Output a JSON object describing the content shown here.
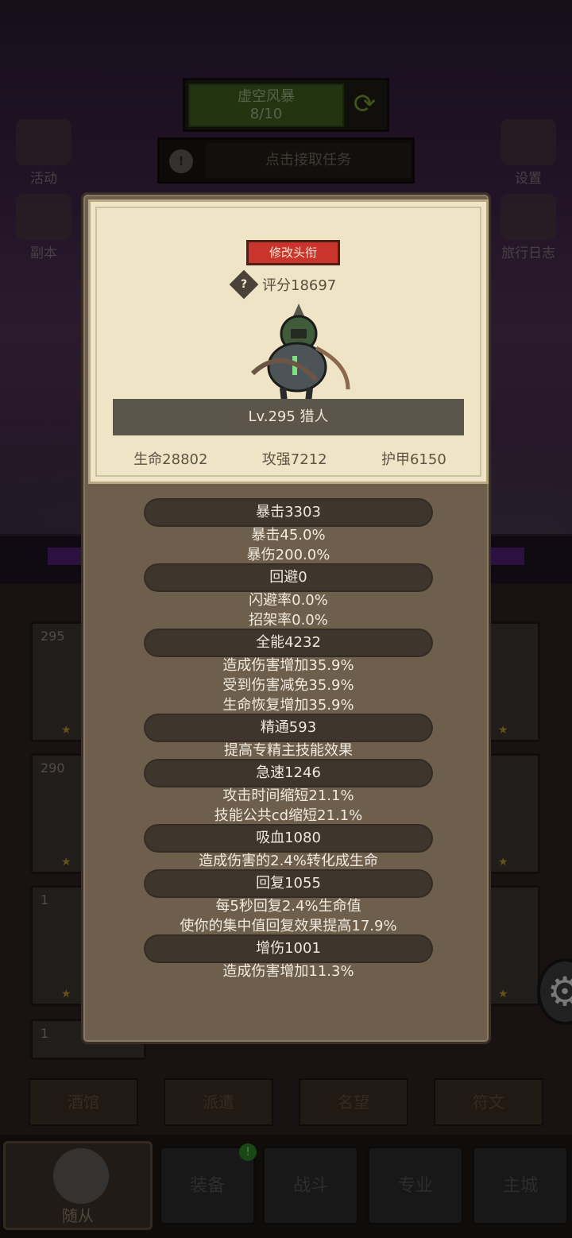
{
  "quest": {
    "title": "虚空风暴",
    "progress": "8/10",
    "task_label": "点击接取任务"
  },
  "side_menu": {
    "left": [
      {
        "label": "活动",
        "icon": "scroll-icon"
      },
      {
        "label": "副本",
        "icon": "portal-icon"
      }
    ],
    "right": [
      {
        "label": "设置",
        "icon": "gear-icon"
      },
      {
        "label": "旅行日志",
        "icon": "book-icon"
      }
    ]
  },
  "grid": {
    "cards": [
      {
        "level": "295"
      },
      {
        "level": "290"
      },
      {
        "level": "1"
      },
      {
        "level": "1"
      }
    ]
  },
  "sub_tabs": [
    "酒馆",
    "派遣",
    "名望",
    "符文"
  ],
  "bottom_nav": [
    {
      "label": "随从",
      "active": true
    },
    {
      "label": "装备",
      "badge": "!"
    },
    {
      "label": "战斗"
    },
    {
      "label": "专业"
    },
    {
      "label": "主城"
    }
  ],
  "modal": {
    "rename_label": "修改头衔",
    "help_glyph": "?",
    "score": "评分18697",
    "hero_title": "Lv.295 猎人",
    "base_stats": {
      "hp": "生命28802",
      "attack": "攻强7212",
      "armor": "护甲6150"
    },
    "stats": [
      {
        "header": "暴击3303",
        "lines": [
          "暴击45.0%",
          "暴伤200.0%"
        ]
      },
      {
        "header": "回避0",
        "lines": [
          "闪避率0.0%",
          "招架率0.0%"
        ]
      },
      {
        "header": "全能4232",
        "lines": [
          "造成伤害增加35.9%",
          "受到伤害减免35.9%",
          "生命恢复增加35.9%"
        ]
      },
      {
        "header": "精通593",
        "lines": [
          "提高专精主技能效果"
        ]
      },
      {
        "header": "急速1246",
        "lines": [
          "攻击时间缩短21.1%",
          "技能公共cd缩短21.1%"
        ]
      },
      {
        "header": "吸血1080",
        "lines": [
          "造成伤害的2.4%转化成生命"
        ]
      },
      {
        "header": "回复1055",
        "lines": [
          "每5秒回复2.4%生命值",
          "使你的集中值回复效果提高17.9%"
        ]
      },
      {
        "header": "增伤1001",
        "lines": [
          "造成伤害增加11.3%"
        ]
      }
    ]
  },
  "colors": {
    "rename_button": "#c9352d",
    "panel": "#6d5f4c",
    "parchment": "#efe4c6",
    "stat_header": "#3e362d"
  }
}
